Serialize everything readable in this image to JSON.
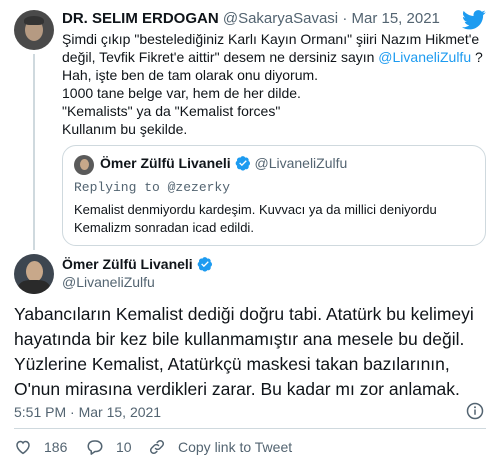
{
  "colors": {
    "accent": "#1d9bf0",
    "text": "#0f1419",
    "muted": "#536471",
    "like": "#536471"
  },
  "reply_tweet": {
    "name": "DR. SELIM ERDOGAN",
    "handle": "@SakaryaSavasi",
    "dot": "·",
    "date": "Mar 15, 2021",
    "lines": [
      "Şimdi çıkıp \"bestelediğiniz Karlı Kayın Ormanı\" şiiri Nazım Hikmet'e",
      "değil, Tevfik Fikret'e aittir\" desem ne dersiniz sayın ",
      "Hah, işte ben de tam olarak onu diyorum.",
      "1000 tane belge var, hem de her dilde.",
      "\"Kemalists\" ya da \"Kemalist forces\"",
      "Kullanım bu şekilde."
    ],
    "mention": "@LivaneliZulfu",
    "line2_tail": " ?"
  },
  "quoted_tweet": {
    "name": "Ömer Zülfü Livaneli",
    "handle": "@LivaneliZulfu",
    "replying": "Replying to @zezerky",
    "lines": [
      "Kemalist denmiyordu kardeşim. Kuvvacı ya da millici deniyordu",
      "Kemalizm sonradan icad edildi."
    ]
  },
  "main_tweet": {
    "name": "Ömer Zülfü Livaneli",
    "handle": "@LivaneliZulfu",
    "lines": [
      "Yabancıların Kemalist dediği doğru tabi. Atatürk bu kelimeyi",
      "hayatında bir kez bile kullanmamıştır ana mesele bu değil.",
      "Yüzlerine Kemalist, Atatürkçü maskesi takan bazılarının,",
      "O'nun mirasına verdikleri zarar. Bu kadar mı zor anlamak."
    ],
    "time": "5:51 PM",
    "dot": "·",
    "date": "Mar 15, 2021"
  },
  "actions": {
    "like_count": "186",
    "reply_count": "10",
    "copy_link": "Copy link to Tweet"
  },
  "icons": [
    "twitter-bird-icon",
    "verified-icon",
    "info-icon",
    "heart-icon",
    "reply-icon",
    "link-icon"
  ]
}
